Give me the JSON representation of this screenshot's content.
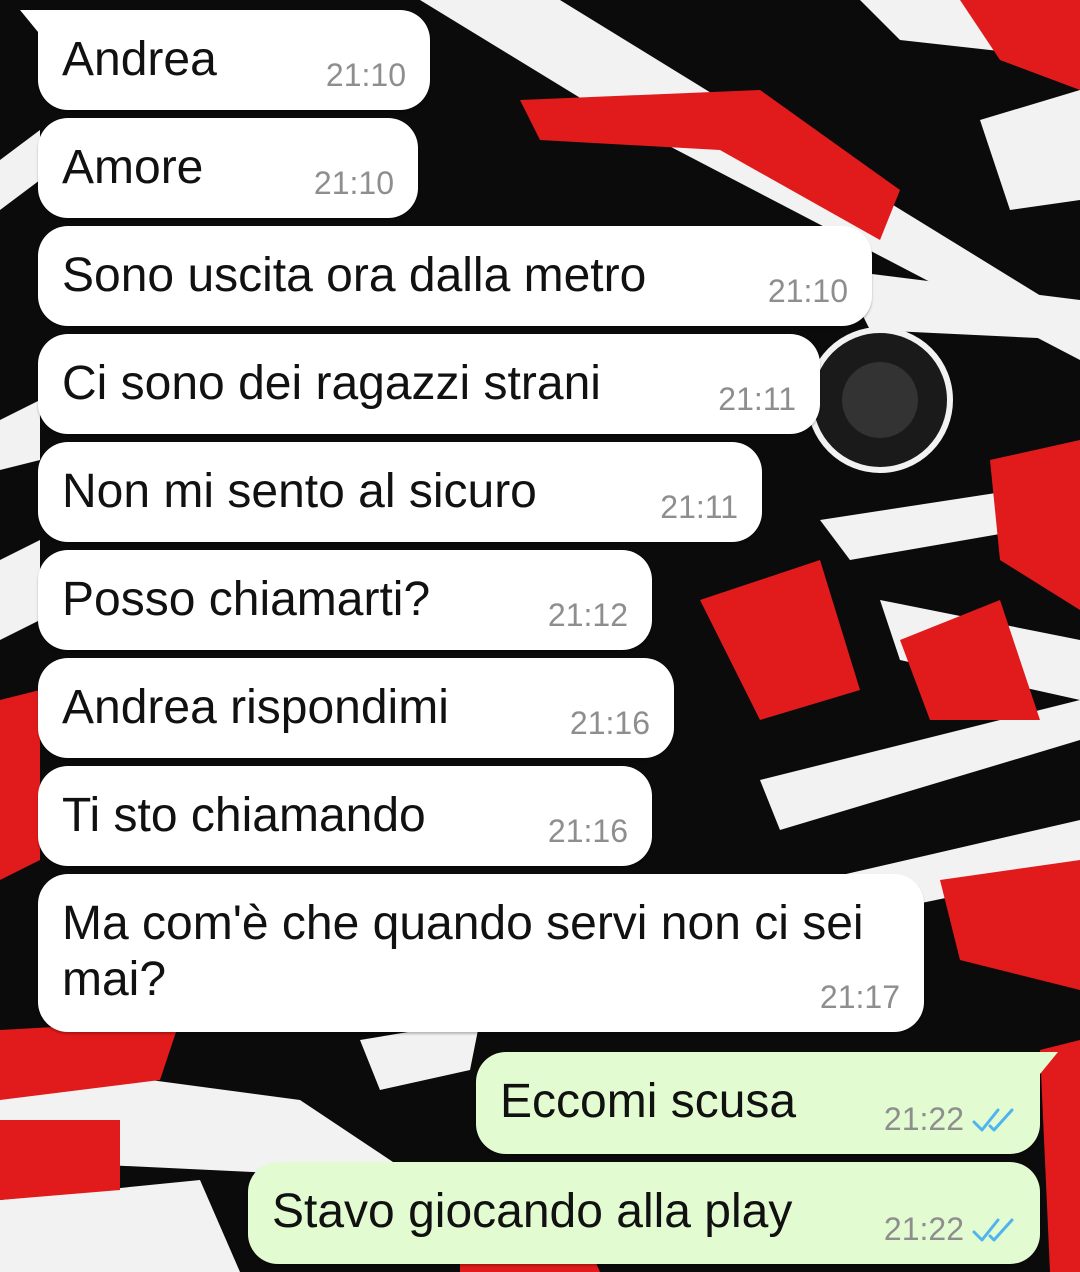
{
  "colors": {
    "incoming_bubble": "#ffffff",
    "outgoing_bubble": "#e2fbd0",
    "timestamp": "#8e8e8e",
    "read_ticks": "#4fb3f0",
    "wallpaper_red": "#e11b1b",
    "wallpaper_black": "#0b0b0b",
    "wallpaper_white": "#f2f2f2"
  },
  "messages": [
    {
      "direction": "in",
      "text": "Andrea",
      "time": "21:10"
    },
    {
      "direction": "in",
      "text": "Amore",
      "time": "21:10"
    },
    {
      "direction": "in",
      "text": "Sono uscita ora dalla metro",
      "time": "21:10"
    },
    {
      "direction": "in",
      "text": "Ci sono dei ragazzi strani",
      "time": "21:11"
    },
    {
      "direction": "in",
      "text": "Non mi sento al sicuro",
      "time": "21:11"
    },
    {
      "direction": "in",
      "text": "Posso chiamarti?",
      "time": "21:12"
    },
    {
      "direction": "in",
      "text": "Andrea rispondimi",
      "time": "21:16"
    },
    {
      "direction": "in",
      "text": "Ti sto chiamando",
      "time": "21:16"
    },
    {
      "direction": "in",
      "text": "Ma com'è che quando servi non ci sei\nmai?",
      "time": "21:17"
    },
    {
      "direction": "out",
      "text": "Eccomi scusa",
      "time": "21:22",
      "status_icon": "double-check-read-icon"
    },
    {
      "direction": "out",
      "text": "Stavo giocando alla play",
      "time": "21:22",
      "status_icon": "double-check-read-icon"
    }
  ]
}
